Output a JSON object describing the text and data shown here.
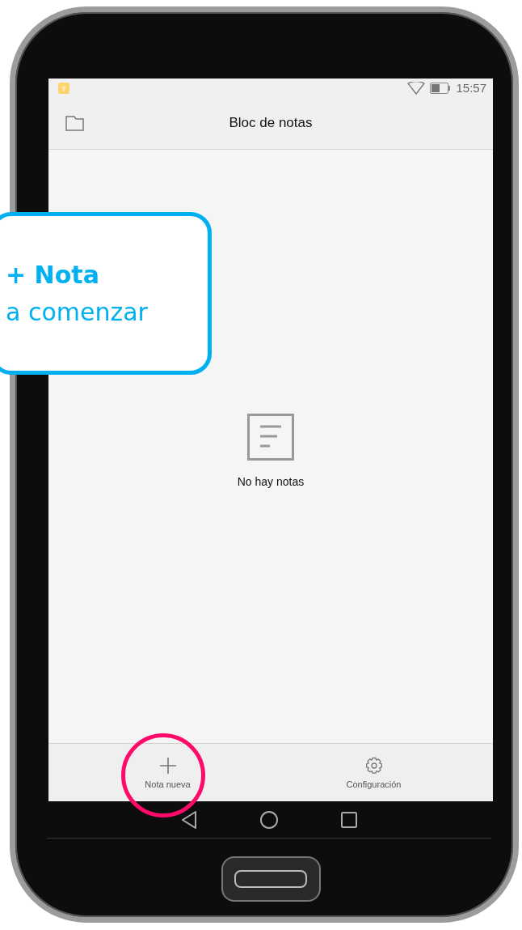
{
  "status_bar": {
    "time": "15:57"
  },
  "app_bar": {
    "title": "Bloc de notas"
  },
  "empty_state": {
    "message": "No hay notas"
  },
  "bottom_bar": {
    "items": [
      {
        "label": "Nota nueva",
        "kind": "add",
        "highlighted": true
      },
      {
        "label": "Configuración",
        "kind": "settings",
        "highlighted": false
      }
    ]
  },
  "callout": {
    "title": "+ Nota",
    "text": "a comenzar"
  }
}
